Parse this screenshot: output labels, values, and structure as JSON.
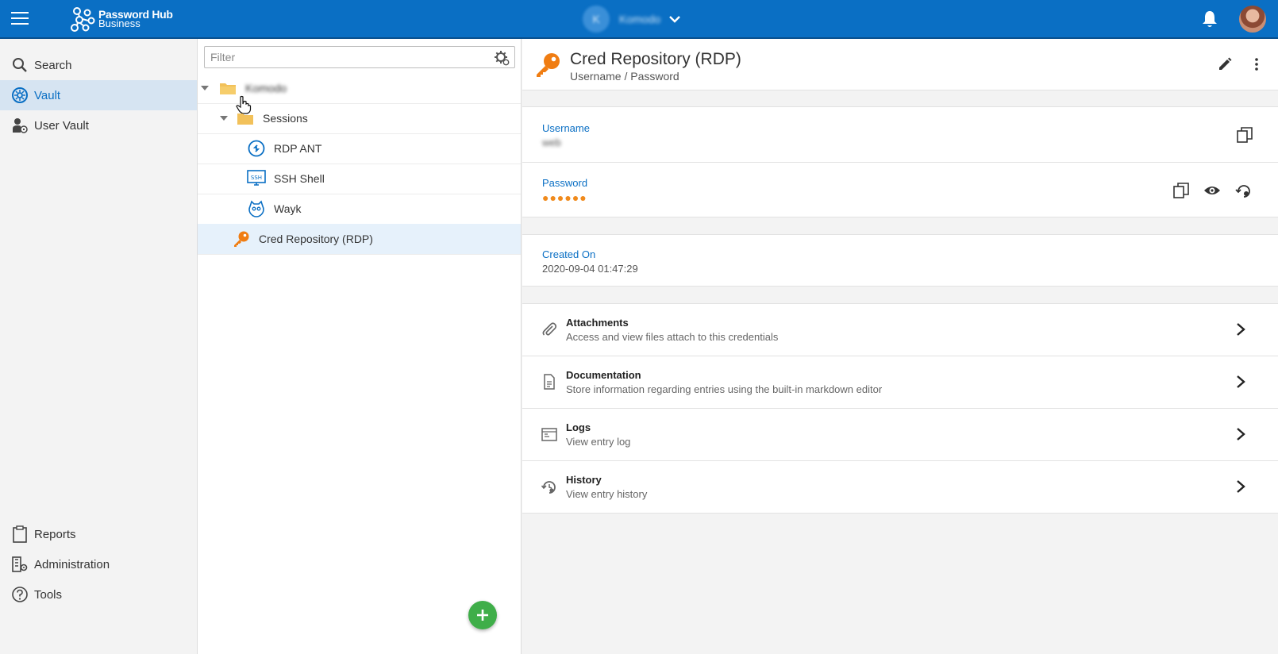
{
  "topbar": {
    "menu_icon": "hamburger-icon",
    "logo_line1": "Password Hub",
    "logo_line2": "Business",
    "workspace_initial": "K",
    "workspace_name": "Komodo",
    "notifications_icon": "bell-icon",
    "accent_color": "#0a6fc4"
  },
  "sidebar": {
    "items": [
      {
        "label": "Search",
        "icon": "search-icon"
      },
      {
        "label": "Vault",
        "icon": "vault-icon",
        "active": true
      },
      {
        "label": "User Vault",
        "icon": "user-vault-icon"
      },
      {
        "label": "Reports",
        "icon": "clipboard-icon"
      },
      {
        "label": "Administration",
        "icon": "building-gear-icon"
      },
      {
        "label": "Tools",
        "icon": "help-circle-icon"
      }
    ]
  },
  "tree": {
    "filter_placeholder": "Filter",
    "rows": [
      {
        "label": "Komodo",
        "icon": "folder-icon",
        "expanded": true
      },
      {
        "label": "Sessions",
        "icon": "folder-icon",
        "expanded": true
      },
      {
        "label": "RDP ANT",
        "icon": "rdp-icon"
      },
      {
        "label": "SSH Shell",
        "icon": "ssh-icon"
      },
      {
        "label": "Wayk",
        "icon": "wayk-icon"
      },
      {
        "label": "Cred Repository (RDP)",
        "icon": "key-icon",
        "selected": true
      }
    ],
    "add_button_icon": "plus-icon",
    "add_button_color": "#3fae49"
  },
  "detail": {
    "title": "Cred Repository (RDP)",
    "subtitle": "Username / Password",
    "username_label": "Username",
    "username_value": "web",
    "password_label": "Password",
    "password_value": "●●●●●●",
    "created_label": "Created On",
    "created_value": "2020-09-04 01:47:29",
    "sections": [
      {
        "title": "Attachments",
        "description": "Access and view files attach to this credentials",
        "icon": "paperclip-icon"
      },
      {
        "title": "Documentation",
        "description": "Store information regarding entries using the built-in markdown editor",
        "icon": "document-icon"
      },
      {
        "title": "Logs",
        "description": "View entry log",
        "icon": "log-icon"
      },
      {
        "title": "History",
        "description": "View entry history",
        "icon": "history-icon"
      }
    ]
  }
}
